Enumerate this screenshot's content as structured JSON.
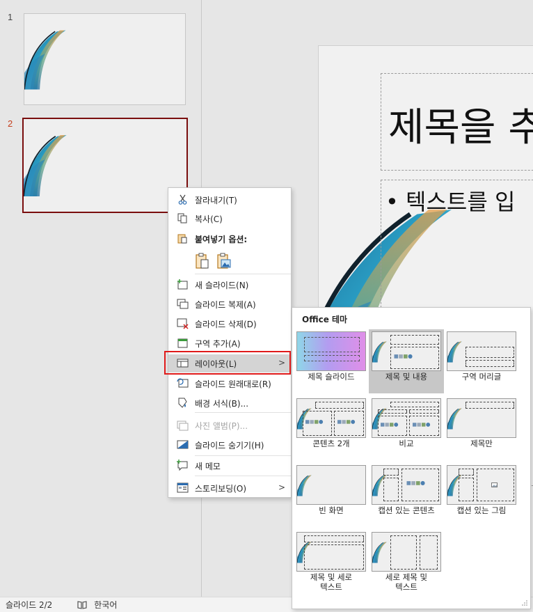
{
  "thumbnails": [
    {
      "number": "1"
    },
    {
      "number": "2"
    }
  ],
  "slide": {
    "title": "제목을 추",
    "body": "• 텍스트를 입"
  },
  "status_bar": {
    "slide_indicator": "슬라이드 2/2",
    "language": "한국어"
  },
  "context_menu": {
    "items": [
      {
        "label": "잘라내기(T)",
        "icon": "scissors-icon"
      },
      {
        "label": "복사(C)",
        "icon": "copy-icon"
      },
      {
        "label": "붙여넣기 옵션:",
        "icon": "paste-icon"
      },
      {
        "label": "새 슬라이드(N)",
        "icon": "new-slide-icon"
      },
      {
        "label": "슬라이드 복제(A)",
        "icon": "duplicate-slide-icon"
      },
      {
        "label": "슬라이드 삭제(D)",
        "icon": "delete-slide-icon"
      },
      {
        "label": "구역 추가(A)",
        "icon": "add-section-icon"
      },
      {
        "label": "레이아웃(L)",
        "icon": "layout-icon"
      },
      {
        "label": "슬라이드 원래대로(R)",
        "icon": "reset-slide-icon"
      },
      {
        "label": "배경 서식(B)...",
        "icon": "format-background-icon"
      },
      {
        "label": "사진 앨범(P)...",
        "icon": "photo-album-icon"
      },
      {
        "label": "슬라이드 숨기기(H)",
        "icon": "hide-slide-icon"
      },
      {
        "label": "새 메모",
        "icon": "new-comment-icon"
      },
      {
        "label": "스토리보딩(O)",
        "icon": "storyboarding-icon"
      }
    ],
    "submenu_arrow": ">"
  },
  "layout_submenu": {
    "title": "Office 테마",
    "layouts": [
      {
        "label": "제목 슬라이드"
      },
      {
        "label": "제목 및 내용"
      },
      {
        "label": "구역 머리글"
      },
      {
        "label": "콘텐츠 2개"
      },
      {
        "label": "비교"
      },
      {
        "label": "제목만"
      },
      {
        "label": "빈 화면"
      },
      {
        "label": "캡션 있는 콘텐츠"
      },
      {
        "label": "캡션 있는 그림"
      },
      {
        "label": "제목 및 세로\n텍스트"
      },
      {
        "label": "세로 제목 및\n텍스트"
      }
    ]
  },
  "colors": {
    "accent_red": "#e01a1a",
    "selected_thumb_border": "#7a0e0e",
    "slide_number_active": "#c43e1c"
  }
}
